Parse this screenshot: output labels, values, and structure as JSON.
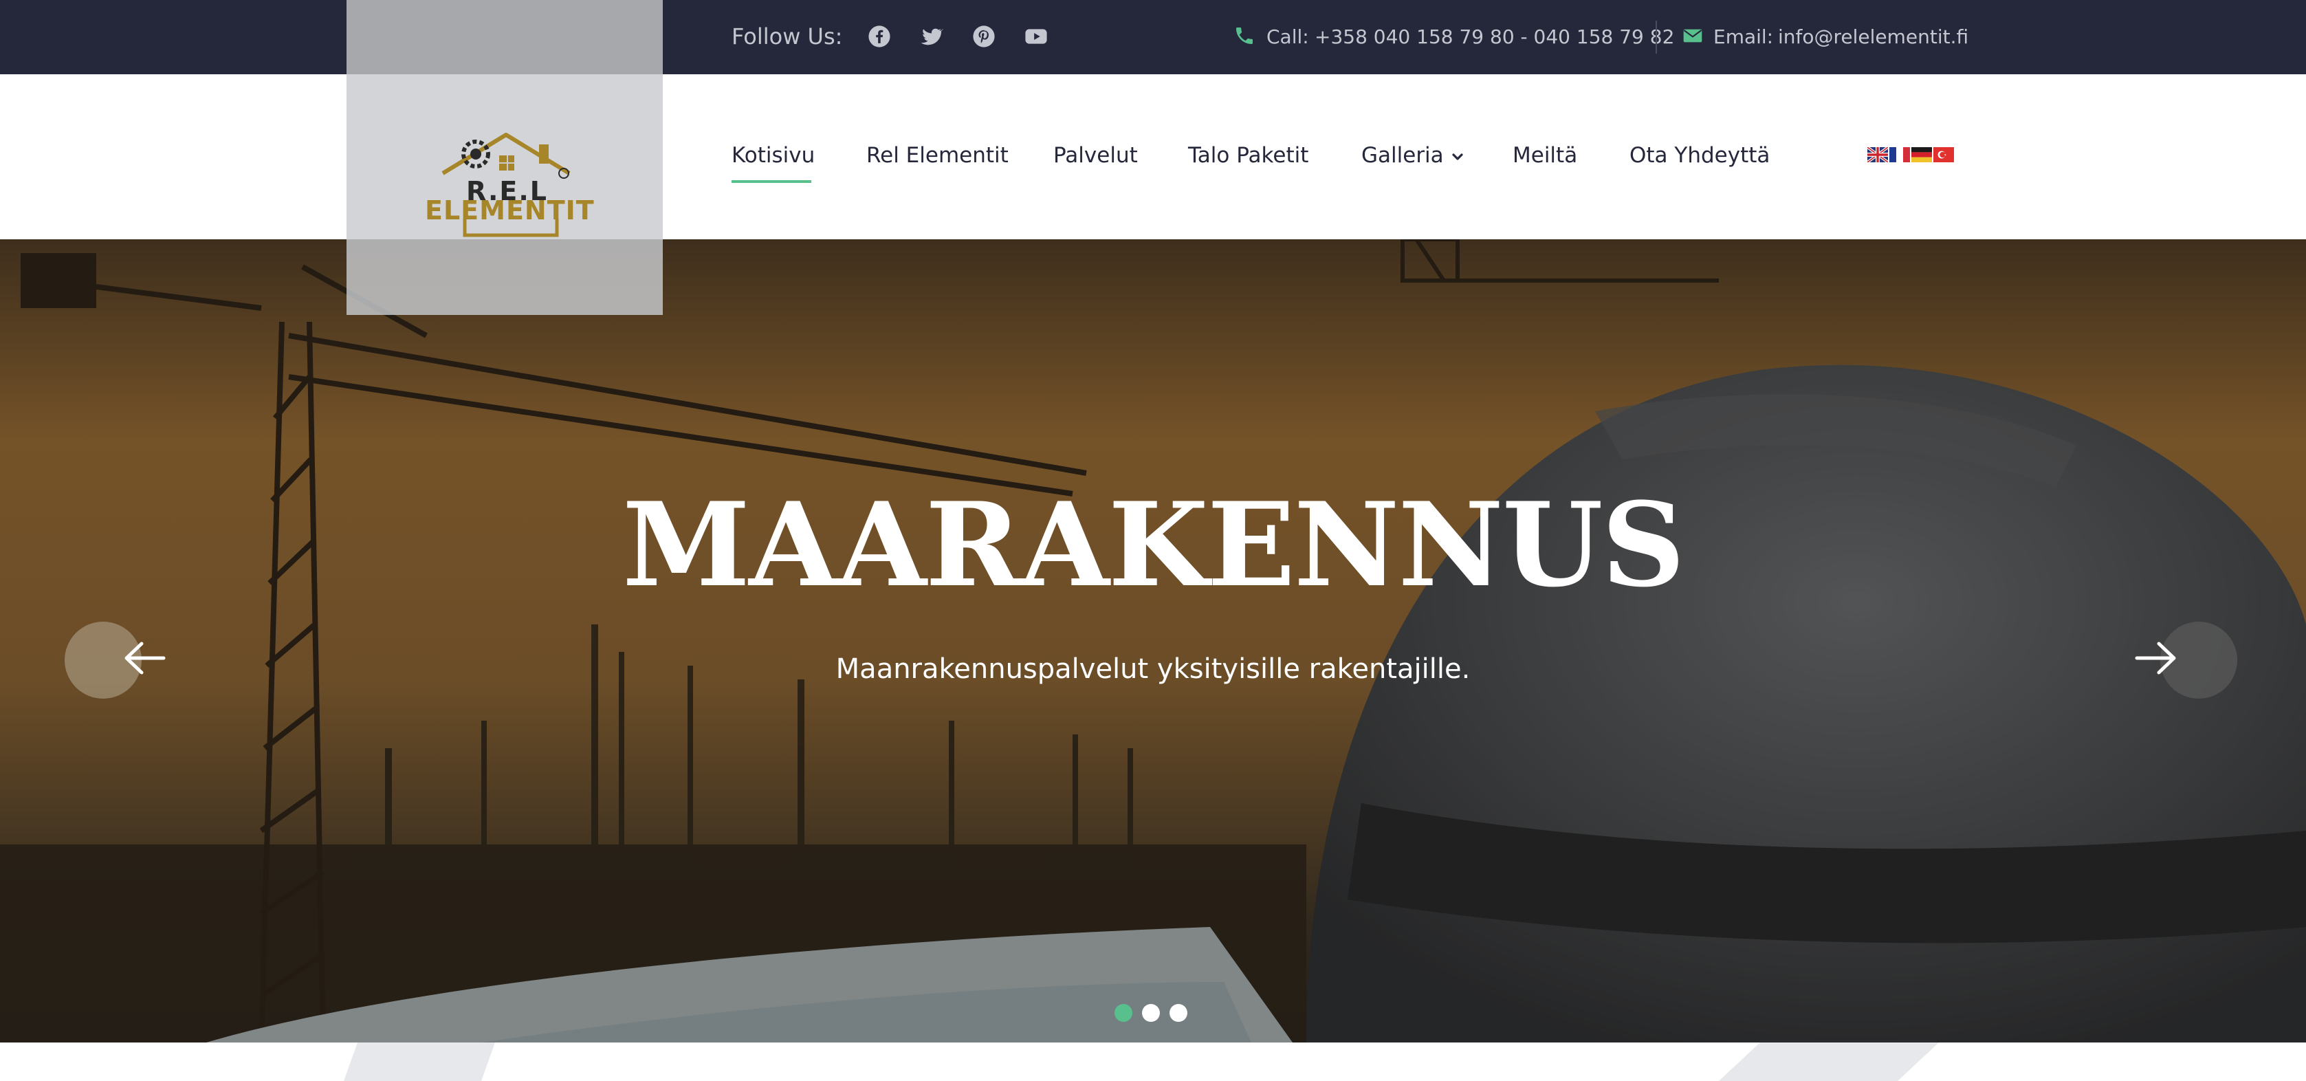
{
  "topbar": {
    "follow_label": "Follow Us:",
    "social_icons": [
      "facebook-icon",
      "twitter-icon",
      "pinterest-icon",
      "youtube-icon"
    ],
    "call_label": "Call:",
    "call_number": "+358 040 158 79 80 - 040 158 79 82",
    "email_label": "Email:",
    "email_value": "info@relelementit.fi"
  },
  "logo": {
    "line1": "R.E.L",
    "line2": "ELEMENTIT"
  },
  "nav": {
    "items": [
      {
        "label": "Kotisivu",
        "active": true
      },
      {
        "label": "Rel Elementit"
      },
      {
        "label": "Palvelut"
      },
      {
        "label": "Talo Paketit"
      },
      {
        "label": "Galleria",
        "has_dropdown": true
      },
      {
        "label": "Meiltä"
      },
      {
        "label": "Ota Yhdeyttä"
      }
    ],
    "languages": [
      "English",
      "French",
      "German",
      "Turkish"
    ]
  },
  "hero": {
    "title": "MAARAKENNUS",
    "subtitle": "Maanrakennuspalvelut yksityisille rakentajille.",
    "slides_count": 3,
    "active_slide": 1
  },
  "colors": {
    "topbar_bg": "#25273b",
    "accent": "#58c08d",
    "nav_text": "#25273b",
    "logo_gold": "#a7862a"
  }
}
